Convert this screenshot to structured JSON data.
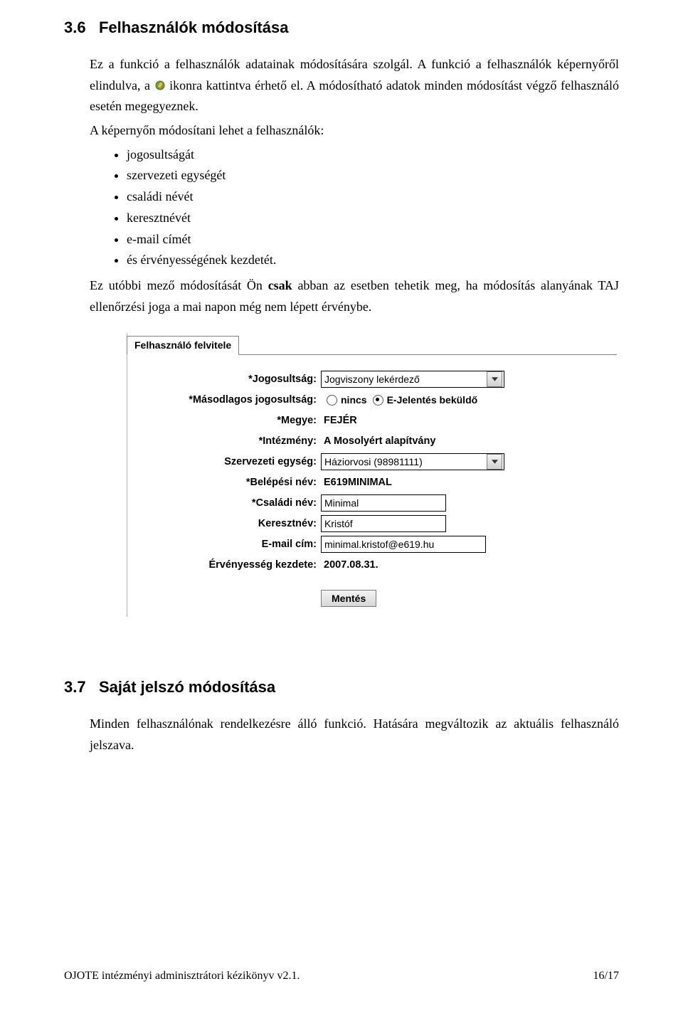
{
  "section36": {
    "number": "3.6",
    "title": "Felhasználók módosítása",
    "p1a": "Ez a funkció a felhasználók adatainak módosítására szolgál. A funkció a felhasználók képernyőről elindulva, a ",
    "p1b": " ikonra kattintva érhető el. A módosítható adatok minden módosítást végző felhasználó esetén megegyeznek.",
    "p2": "A képernyőn módosítani lehet a felhasználók:",
    "bullets": [
      "jogosultságát",
      "szervezeti egységét",
      "családi névét",
      "keresztnévét",
      "e-mail címét",
      "és érvényességének kezdetét."
    ],
    "p3a": "Ez utóbbi mező módosítását Ön ",
    "p3bold": "csak",
    "p3b": " abban az esetben tehetik meg, ha módosítás alanyának TAJ ellenőrzési joga a mai napon még nem lépett érvénybe."
  },
  "form": {
    "tab": "Felhasználó felvitele",
    "labels": {
      "jogosultsag": "*Jogosultság:",
      "masodlagos": "*Másodlagos jogosultság:",
      "megye": "*Megye:",
      "intezmeny": "*Intézmény:",
      "szervezeti": "Szervezeti egység:",
      "belepesi": "*Belépési név:",
      "csaladi": "*Családi név:",
      "kereszt": "Keresztnév:",
      "email": "E-mail cím:",
      "ervenyesseg": "Érvényesség kezdete:"
    },
    "values": {
      "jogosultsag": "Jogviszony lekérdező",
      "radio_nincs": "nincs",
      "radio_ejelentes": "E-Jelentés beküldő",
      "megye": "FEJÉR",
      "intezmeny": "A Mosolyért alapítvány",
      "szervezeti": "Háziorvosi (98981111)",
      "belepesi": "E619MINIMAL",
      "csaladi": "Minimal",
      "kereszt": "Kristóf",
      "email": "minimal.kristof@e619.hu",
      "ervenyesseg": "2007.08.31."
    },
    "save": "Mentés"
  },
  "section37": {
    "number": "3.7",
    "title": "Saját jelszó módosítása",
    "p1": "Minden felhasználónak rendelkezésre álló funkció. Hatására megváltozik az aktuális felhasználó jelszava."
  },
  "footer": {
    "left": "OJOTE intézményi adminisztrátori kézikönyv v2.1.",
    "right": "16/17"
  }
}
